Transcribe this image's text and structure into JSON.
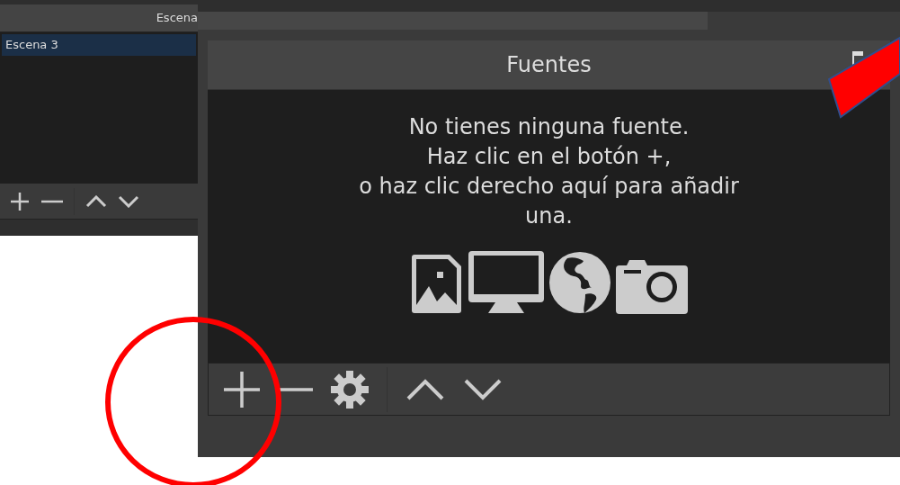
{
  "scenes_panel": {
    "title": "Escena",
    "items": [
      {
        "label": "Escena 3",
        "selected": true
      }
    ]
  },
  "sources_panel": {
    "title": "Fuentes",
    "empty_message": "No tienes ninguna fuente.\nHaz clic en el botón +,\no haz clic derecho aquí para añadir\nuna."
  }
}
